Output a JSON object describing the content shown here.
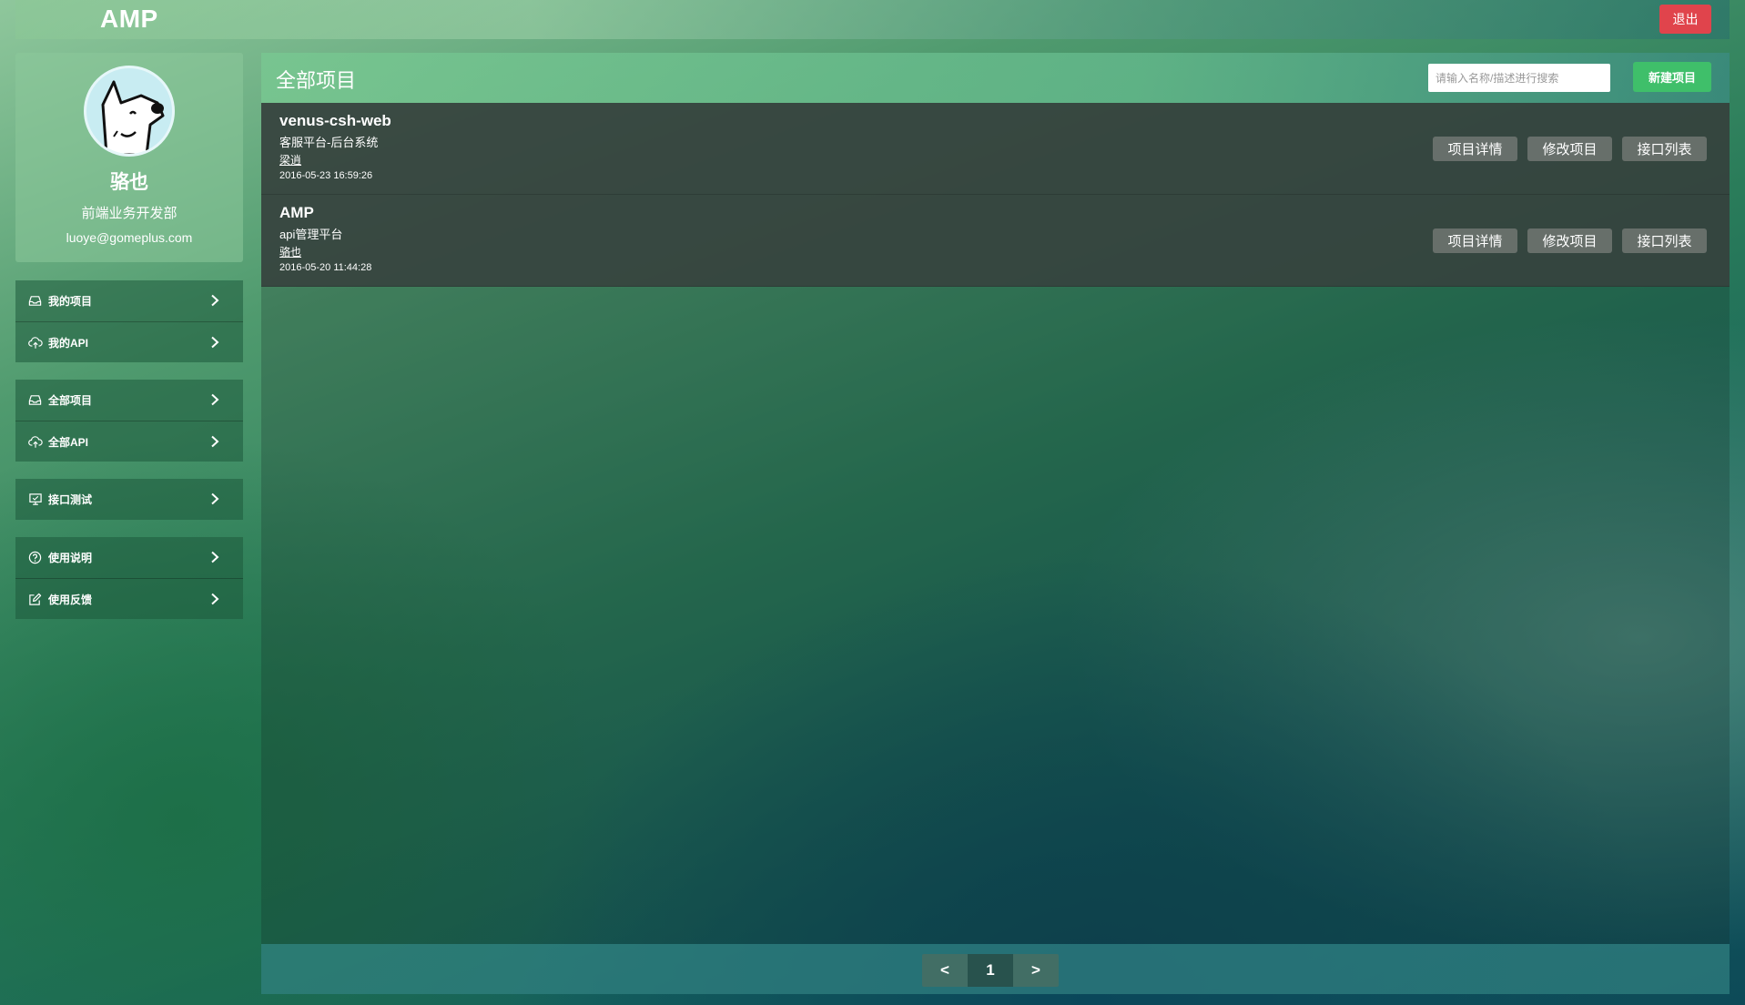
{
  "header": {
    "logo": "AMP",
    "logout_label": "退出",
    "logout_color": "#e0444c"
  },
  "profile": {
    "name": "骆也",
    "department": "前端业务开发部",
    "email": "luoye@gomeplus.com"
  },
  "sidebar": {
    "groups": [
      {
        "items": [
          {
            "icon": "inbox-icon",
            "label": "我的项目"
          },
          {
            "icon": "cloud-upload-icon",
            "label": "我的API"
          }
        ]
      },
      {
        "items": [
          {
            "icon": "inbox-icon",
            "label": "全部项目"
          },
          {
            "icon": "cloud-upload-icon",
            "label": "全部API"
          }
        ]
      },
      {
        "items": [
          {
            "icon": "monitor-icon",
            "label": "接口测试"
          }
        ]
      },
      {
        "items": [
          {
            "icon": "help-circle-icon",
            "label": "使用说明"
          },
          {
            "icon": "edit-icon",
            "label": "使用反馈"
          }
        ]
      }
    ]
  },
  "main": {
    "title": "全部项目",
    "search_placeholder": "请输入名称/描述进行搜索",
    "new_project_label": "新建项目",
    "new_project_color": "#3fbf6a",
    "row_actions": {
      "details": "项目详情",
      "edit": "修改项目",
      "api_list": "接口列表"
    },
    "projects": [
      {
        "name": "venus-csh-web",
        "description": "客服平台-后台系统",
        "owner": "梁逍",
        "created": "2016-05-23 16:59:26"
      },
      {
        "name": "AMP",
        "description": "api管理平台",
        "owner": "骆也",
        "created": "2016-05-20 11:44:28"
      }
    ]
  },
  "pagination": {
    "prev": "<",
    "current": "1",
    "next": ">"
  }
}
